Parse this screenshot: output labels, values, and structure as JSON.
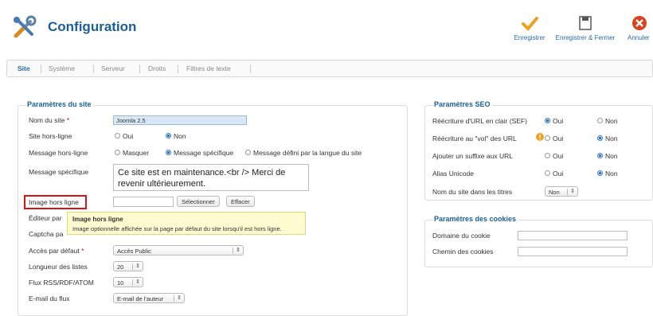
{
  "header": {
    "title": "Configuration",
    "buttons": {
      "save": "Enregistrer",
      "save_close": "Enregistrer & Fermer",
      "cancel": "Annuler"
    }
  },
  "tabs": [
    "Site",
    "Système",
    "Serveur",
    "Droits",
    "Filtres de texte"
  ],
  "site": {
    "legend": "Paramètres du site",
    "sitename_label": "Nom du site",
    "sitename_value": "Joomla 2.5",
    "offline_label": "Site hors-ligne",
    "oui": "Oui",
    "non": "Non",
    "offline_msg_label": "Message hors-ligne",
    "msg_opts": [
      "Masquer",
      "Message spécifique",
      "Message défini par la langue du site"
    ],
    "custom_msg_label": "Message spécifique",
    "custom_msg_value": "Ce site est en maintenance.<br /> Merci de revenir ultérieurement.",
    "offline_image_label": "Image hors ligne",
    "select_btn": "Sélectionner",
    "clear_btn": "Effacer",
    "editor_label": "Éditeur par",
    "captcha_label": "Captcha pa",
    "access_label": "Accès par défaut",
    "access_value": "Accès Public",
    "list_length_label": "Longueur des listes",
    "list_length_value": "20",
    "feed_label": "Flux RSS/RDF/ATOM",
    "feed_value": "10",
    "feed_email_label": "E-mail du flux",
    "feed_email_value": "E-mail de l'auteur"
  },
  "tooltip": {
    "title": "Image hors ligne",
    "text": "Image optionnelle affichée sur la page par défaut du site lorsqu'il est hors ligne."
  },
  "seo": {
    "legend": "Paramètres SEO",
    "rows": [
      {
        "label": "Réécriture d'URL en clair (SEF)",
        "oui": "Oui",
        "non": "Non"
      },
      {
        "label": "Réécriture au \"vol\" des URL",
        "oui": "Oui",
        "non": "Non"
      },
      {
        "label": "Ajouter un suffixe aux URL",
        "oui": "Oui",
        "non": "Non"
      },
      {
        "label": "Alias Unicode",
        "oui": "Oui",
        "non": "Non"
      }
    ],
    "sitename_titles_label": "Nom du site dans les titres",
    "sitename_titles_value": "Non"
  },
  "cookies": {
    "legend": "Paramètres des cookies",
    "domain_label": "Domaine du cookie",
    "path_label": "Chemin des cookies"
  }
}
